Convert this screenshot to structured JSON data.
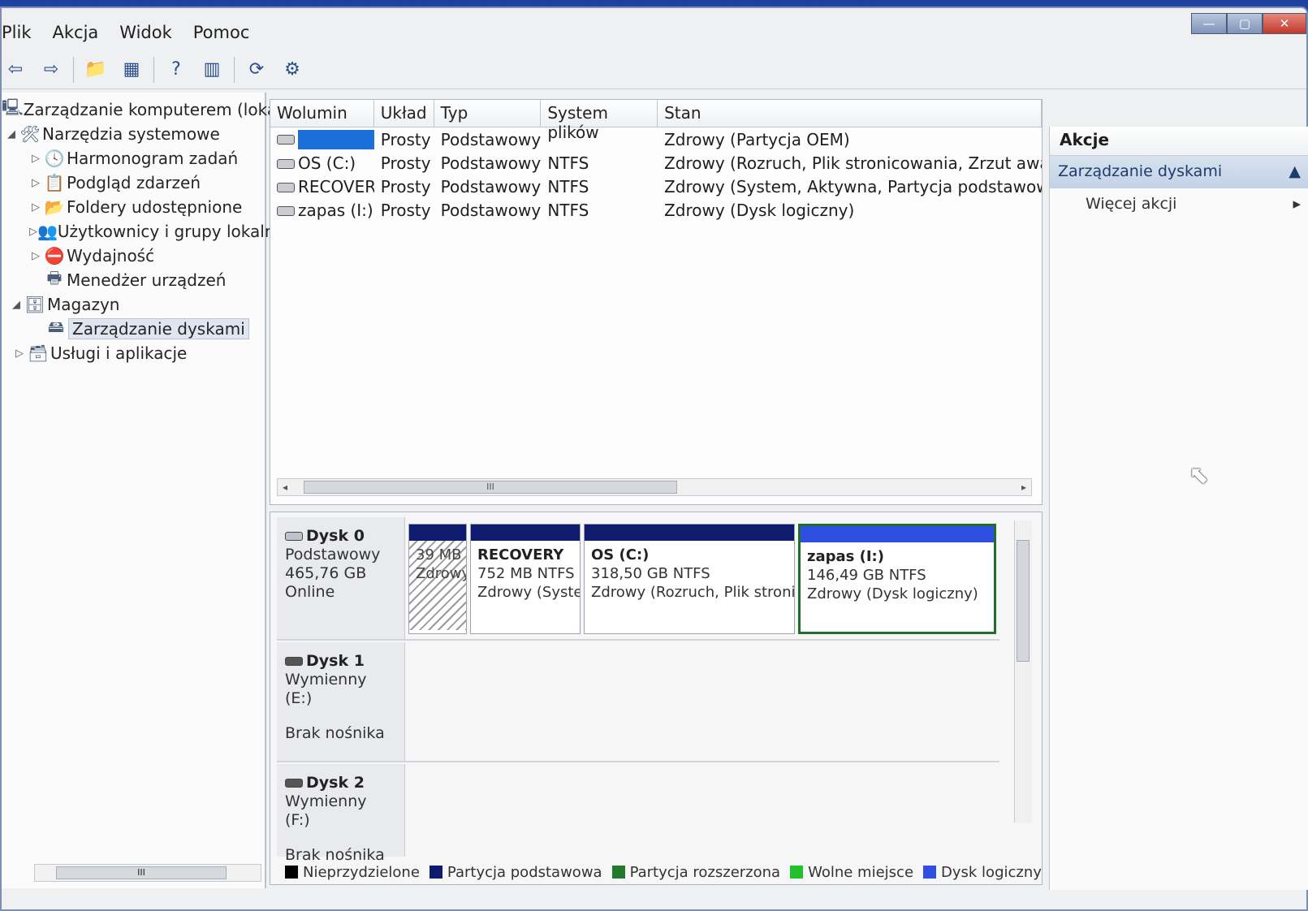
{
  "window": {
    "controls": {
      "minimize": "—",
      "maximize": "▢",
      "close": "✕"
    }
  },
  "menu": [
    "Plik",
    "Akcja",
    "Widok",
    "Pomoc"
  ],
  "tree": {
    "root": "Zarządzanie komputerem (lokalne)",
    "items": [
      {
        "label": "Narzędzia systemowe",
        "expander": "◢"
      },
      {
        "label": "Harmonogram zadań",
        "expander": "▷"
      },
      {
        "label": "Podgląd zdarzeń",
        "expander": "▷"
      },
      {
        "label": "Foldery udostępnione",
        "expander": "▷"
      },
      {
        "label": "Użytkownicy i grupy lokalne",
        "expander": "▷"
      },
      {
        "label": "Wydajność",
        "expander": "▷"
      },
      {
        "label": "Menedżer urządzeń",
        "expander": ""
      },
      {
        "label": "Magazyn",
        "expander": "◢"
      },
      {
        "label": "Zarządzanie dyskami",
        "expander": ""
      },
      {
        "label": "Usługi i aplikacje",
        "expander": "▷"
      }
    ],
    "scroll_thumb": "III"
  },
  "volumes": {
    "headers": [
      "Wolumin",
      "Układ",
      "Typ",
      "System plików",
      "Stan"
    ],
    "rows": [
      {
        "volume": "",
        "layout": "Prosty",
        "type": "Podstawowy",
        "fs": "",
        "status": "Zdrowy (Partycja OEM)"
      },
      {
        "volume": "OS (C:)",
        "layout": "Prosty",
        "type": "Podstawowy",
        "fs": "NTFS",
        "status": "Zdrowy (Rozruch, Plik stronicowania, Zrzut awaryjny, Pa"
      },
      {
        "volume": "RECOVERY",
        "layout": "Prosty",
        "type": "Podstawowy",
        "fs": "NTFS",
        "status": "Zdrowy (System, Aktywna, Partycja podstawowa)"
      },
      {
        "volume": "zapas (I:)",
        "layout": "Prosty",
        "type": "Podstawowy",
        "fs": "NTFS",
        "status": "Zdrowy (Dysk logiczny)"
      }
    ],
    "scroll_thumb": "III",
    "scroll_left": "◂",
    "scroll_right": "▸"
  },
  "disks": [
    {
      "name": "Dysk 0",
      "kind": "Podstawowy",
      "size": "465,76 GB",
      "state": "Online",
      "partitions": [
        {
          "title": "",
          "size": "39 MB",
          "status": "Zdrowy"
        },
        {
          "title": "RECOVERY",
          "size": "752 MB NTFS",
          "status": "Zdrowy (Syste"
        },
        {
          "title": "OS  (C:)",
          "size": "318,50 GB NTFS",
          "status": "Zdrowy (Rozruch, Plik stronic"
        },
        {
          "title": "zapas  (I:)",
          "size": "146,49 GB NTFS",
          "status": "Zdrowy (Dysk logiczny)"
        }
      ]
    },
    {
      "name": "Dysk 1",
      "kind": "Wymienny (E:)",
      "size": "",
      "state": "Brak nośnika"
    },
    {
      "name": "Dysk 2",
      "kind": "Wymienny (F:)",
      "size": "",
      "state": "Brak nośnika"
    }
  ],
  "legend": [
    {
      "label": "Nieprzydzielone",
      "color": "#000000"
    },
    {
      "label": "Partycja podstawowa",
      "color": "#0f1c6e"
    },
    {
      "label": "Partycja rozszerzona",
      "color": "#1e7a2c"
    },
    {
      "label": "Wolne miejsce",
      "color": "#22c02a"
    },
    {
      "label": "Dysk logiczny",
      "color": "#2e4fe0"
    }
  ],
  "actions": {
    "title": "Akcje",
    "section": "Zarządzanie dyskami",
    "section_arrow": "▲",
    "more": "Więcej akcji",
    "more_arrow": "▸"
  },
  "icons": {
    "back": "⇦",
    "forward": "⇨",
    "up": "📁",
    "console": "▦",
    "help": "?",
    "view": "▥",
    "refresh": "⟳",
    "properties": "⚙",
    "computer": "🖳",
    "tools": "🛠",
    "clock": "🕓",
    "event": "📋",
    "share": "📂",
    "users": "👥",
    "perf": "⛔",
    "device": "🖶",
    "storage": "🗄",
    "disk": "🖴",
    "services": "🗃",
    "cursor": "⬉"
  }
}
